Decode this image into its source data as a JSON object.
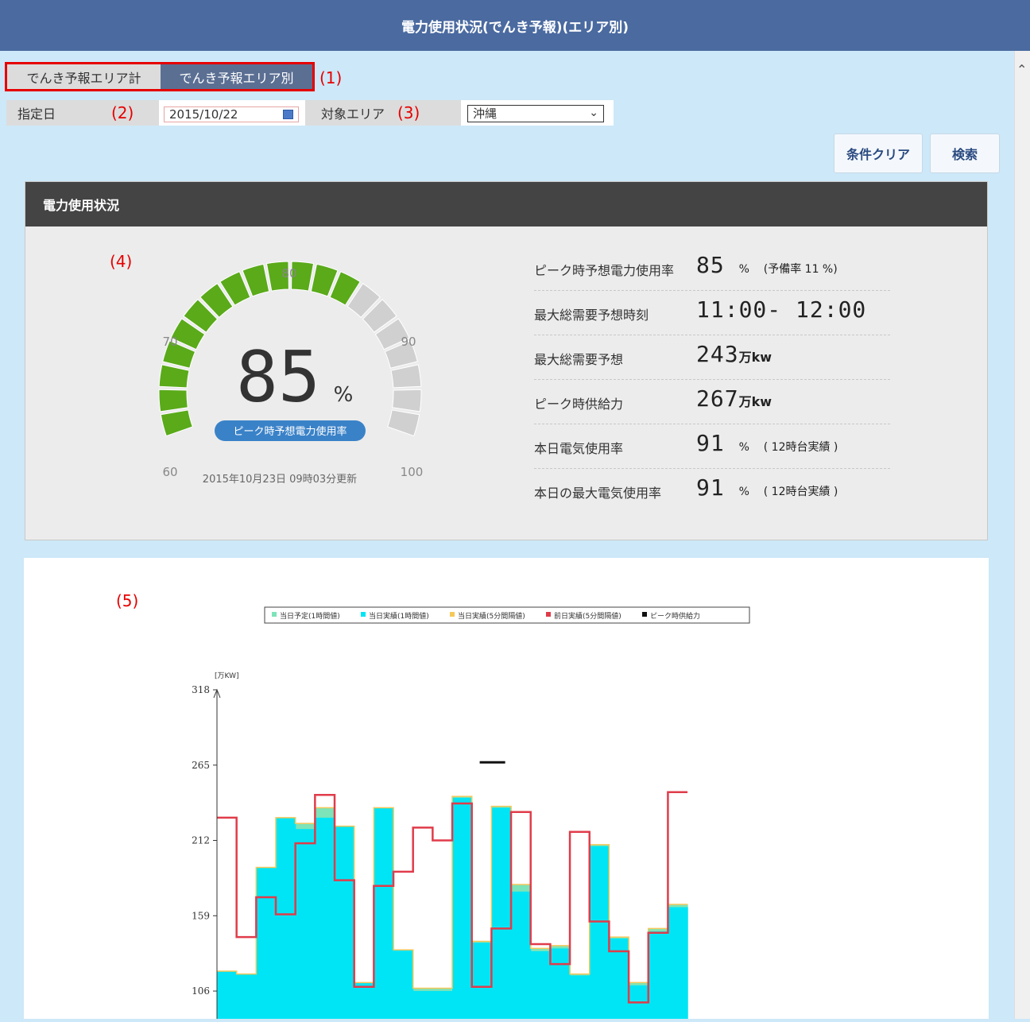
{
  "page": {
    "title": "電力使用状況(でんき予報)(エリア別)"
  },
  "annotations": {
    "tabs": "(1)",
    "date": "(2)",
    "area": "(3)",
    "gauge": "(4)",
    "chart": "(5)"
  },
  "tabs": [
    {
      "label": "でんき予報エリア計",
      "active": false
    },
    {
      "label": "でんき予報エリア別",
      "active": true
    }
  ],
  "conditions": {
    "date_label": "指定日",
    "date_value": "2015/10/22",
    "area_label": "対象エリア",
    "area_value": "沖縄"
  },
  "buttons": {
    "clear": "条件クリア",
    "search": "検索"
  },
  "panel": {
    "title": "電力使用状況"
  },
  "gauge": {
    "value": 85,
    "value_text": "85",
    "unit": "%",
    "badge": "ピーク時予想電力使用率",
    "updated": "2015年10月23日 09時03分更新",
    "min": 60,
    "max": 100,
    "tick_labels": [
      "60",
      "70",
      "80",
      "90",
      "100"
    ],
    "colors": {
      "filled": "#5aaa1a",
      "empty": "#d0d0d0",
      "badge": "#3a82c8"
    }
  },
  "stats": [
    {
      "label": "ピーク時予想電力使用率",
      "value": "85",
      "unit": "%",
      "note": "(予備率 11 %)"
    },
    {
      "label": "最大総需要予想時刻",
      "value": "11:00- 12:00",
      "unit": "",
      "note": ""
    },
    {
      "label": "最大総需要予想",
      "value": "243",
      "unit": "万kw",
      "note": ""
    },
    {
      "label": "ピーク時供給力",
      "value": "267",
      "unit": "万kw",
      "note": ""
    },
    {
      "label": "本日電気使用率",
      "value": "91",
      "unit": "%",
      "note": "( 12時台実績 )"
    },
    {
      "label": "本日の最大電気使用率",
      "value": "91",
      "unit": "%",
      "note": "( 12時台実績 )"
    }
  ],
  "chart_data": {
    "type": "area",
    "ylabel": "[万KW]",
    "yticks": [
      106,
      159,
      212,
      265,
      318
    ],
    "legend": [
      {
        "name": "当日予定(1時間値)",
        "color": "#7de3b8"
      },
      {
        "name": "当日実績(1時間値)",
        "color": "#00e5f5"
      },
      {
        "name": "当日実績(5分間隔値)",
        "color": "#f5c85a"
      },
      {
        "name": "前日実績(5分間隔値)",
        "color": "#e03c4a"
      },
      {
        "name": "ピーク時供給力",
        "color": "#111111"
      }
    ],
    "peak_supply": 267,
    "series": [
      {
        "name": "当日実績(1時間値)",
        "values": [
          120,
          118,
          193,
          228,
          220,
          228,
          222,
          112,
          235,
          135,
          106,
          106,
          242,
          140,
          235,
          176,
          134,
          136,
          117,
          208,
          143,
          110,
          148,
          165
        ]
      },
      {
        "name": "当日予定(1時間値)",
        "values": [
          120,
          118,
          193,
          228,
          224,
          235,
          222,
          112,
          235,
          135,
          108,
          108,
          243,
          141,
          236,
          181,
          136,
          138,
          118,
          209,
          144,
          112,
          150,
          167
        ]
      },
      {
        "name": "前日実績(5分間隔値)",
        "values": [
          228,
          144,
          172,
          160,
          210,
          244,
          184,
          109,
          180,
          190,
          221,
          212,
          238,
          109,
          150,
          232,
          139,
          125,
          218,
          155,
          134,
          98,
          147,
          246
        ]
      }
    ]
  }
}
